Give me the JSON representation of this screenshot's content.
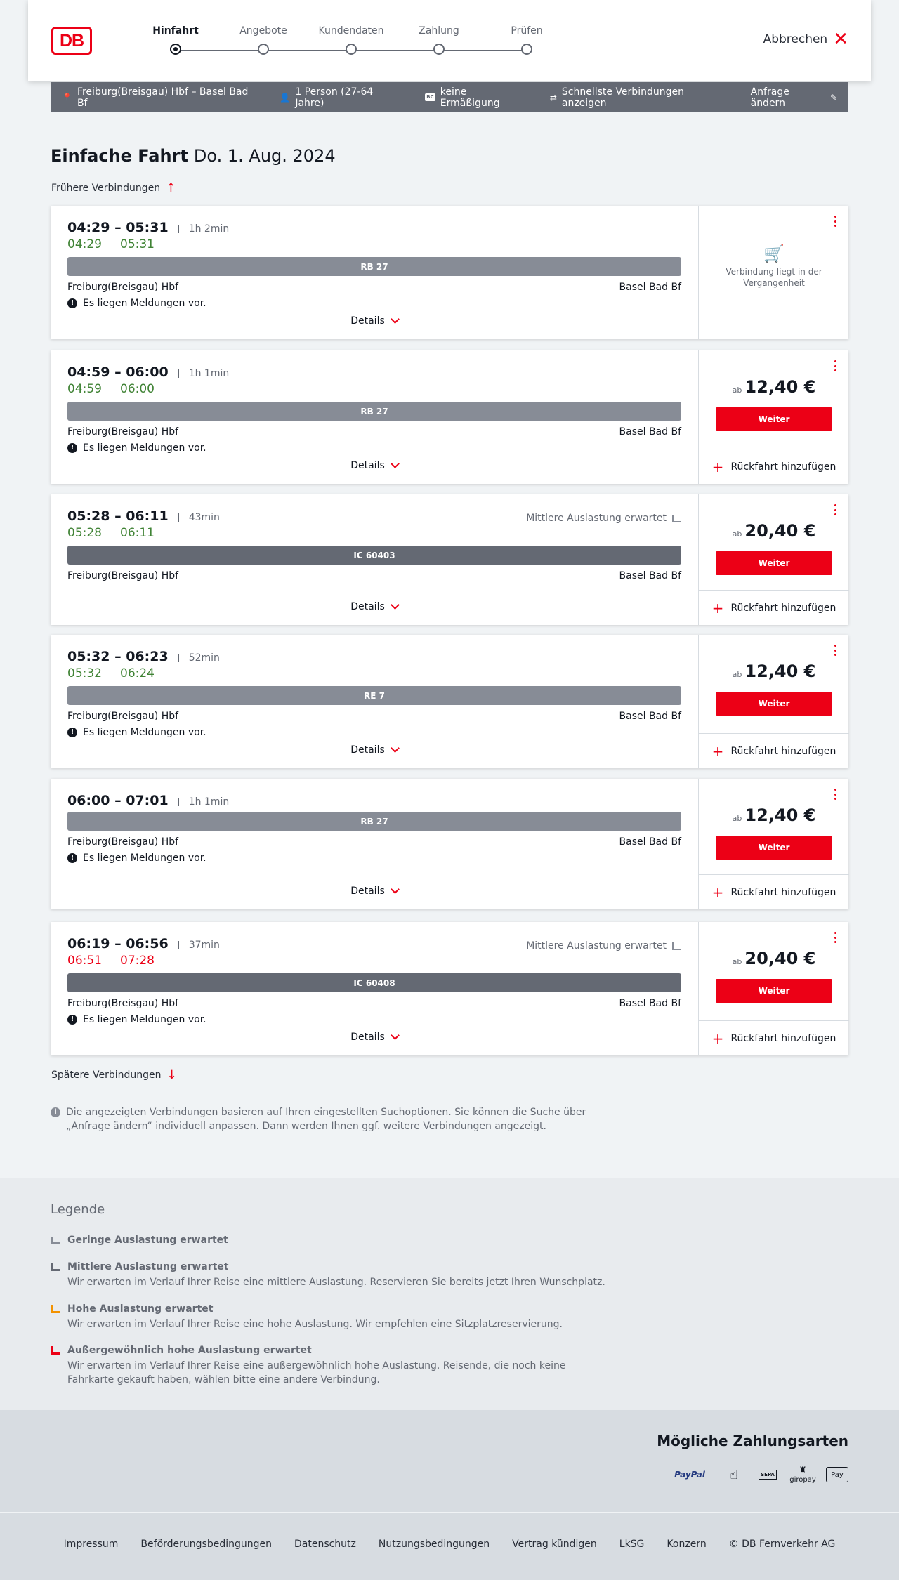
{
  "header": {
    "logo": "DB",
    "steps": [
      {
        "label": "Hinfahrt",
        "active": true
      },
      {
        "label": "Angebote"
      },
      {
        "label": "Kundendaten"
      },
      {
        "label": "Zahlung"
      },
      {
        "label": "Prüfen"
      }
    ],
    "cancel": "Abbrechen"
  },
  "bar": {
    "route": "Freiburg(Breisgau) Hbf – Basel Bad Bf",
    "persons": "1 Person (27-64 Jahre)",
    "discount": "keine Ermäßigung",
    "fastest": "Schnellste Verbindungen anzeigen",
    "edit": "Anfrage ändern"
  },
  "page": {
    "title": "Einfache Fahrt",
    "date": "Do. 1. Aug. 2024",
    "earlier": "Frühere Verbindungen",
    "later": "Spätere Verbindungen"
  },
  "labels": {
    "details": "Details",
    "from": "Freiburg(Breisgau) Hbf",
    "to": "Basel Bad Bf",
    "message": "Es liegen Meldungen vor.",
    "ab": "ab",
    "weiter": "Weiter",
    "return": "Rückfahrt hinzufügen",
    "past": "Verbindung liegt in der Vergangenheit"
  },
  "connections": [
    {
      "times": "04:29 – 05:31",
      "duration": "1h 2min",
      "rt_dep": "04:29",
      "rt_arr": "05:31",
      "late": false,
      "train": "RB 27",
      "train_color": "#878c96",
      "message": true,
      "past": true,
      "price": "",
      "occupancy": ""
    },
    {
      "times": "04:59 – 06:00",
      "duration": "1h 1min",
      "rt_dep": "04:59",
      "rt_arr": "06:00",
      "late": false,
      "train": "RB 27",
      "train_color": "#878c96",
      "message": true,
      "past": false,
      "price": "12,40 €",
      "occupancy": ""
    },
    {
      "times": "05:28 – 06:11",
      "duration": "43min",
      "rt_dep": "05:28",
      "rt_arr": "06:11",
      "late": false,
      "train": "IC 60403",
      "train_color": "#646973",
      "message": false,
      "past": false,
      "price": "20,40 €",
      "occupancy": "Mittlere Auslastung erwartet"
    },
    {
      "times": "05:32 – 06:23",
      "duration": "52min",
      "rt_dep": "05:32",
      "rt_arr": "06:24",
      "late": false,
      "train": "RE 7",
      "train_color": "#878c96",
      "message": true,
      "past": false,
      "price": "12,40 €",
      "occupancy": ""
    },
    {
      "times": "06:00 – 07:01",
      "duration": "1h 1min",
      "rt_dep": "",
      "rt_arr": "",
      "late": false,
      "train": "RB 27",
      "train_color": "#878c96",
      "message": true,
      "past": false,
      "price": "12,40 €",
      "occupancy": ""
    },
    {
      "times": "06:19 – 06:56",
      "duration": "37min",
      "rt_dep": "06:51",
      "rt_arr": "07:28",
      "late": true,
      "train": "IC 60408",
      "train_color": "#646973",
      "message": true,
      "past": false,
      "price": "20,40 €",
      "occupancy": "Mittlere Auslastung erwartet"
    }
  ],
  "info": "Die angezeigten Verbindungen basieren auf Ihren eingestellten Suchoptionen. Sie können die Suche über „Anfrage ändern“ individuell anpassen. Dann werden Ihnen ggf. weitere Verbindungen angezeigt.",
  "legend": {
    "title": "Legende",
    "items": [
      {
        "title": "Geringe Auslastung erwartet",
        "desc": "",
        "color": "#878c96"
      },
      {
        "title": "Mittlere Auslastung erwartet",
        "desc": "Wir erwarten im Verlauf Ihrer Reise eine mittlere Auslastung. Reservieren Sie bereits jetzt Ihren Wunschplatz.",
        "color": "#646973"
      },
      {
        "title": "Hohe Auslastung erwartet",
        "desc": "Wir erwarten im Verlauf Ihrer Reise eine hohe Auslastung. Wir empfehlen eine Sitzplatzreservierung.",
        "color": "#f39200"
      },
      {
        "title": "Außergewöhnlich hohe Auslastung erwartet",
        "desc": "Wir erwarten im Verlauf Ihrer Reise eine außergewöhnlich hohe Auslastung. Reisende, die noch keine Fahrkarte gekauft haben, wählen bitte eine andere Verbindung.",
        "color": "#ec0016"
      }
    ]
  },
  "payment": {
    "title": "Mögliche Zahlungsarten",
    "methods": [
      "PayPal",
      "",
      "SEPA",
      "giropay",
      "Pay"
    ]
  },
  "footer": {
    "links": [
      "Impressum",
      "Beförderungsbedingungen",
      "Datenschutz",
      "Nutzungsbedingungen",
      "Vertrag kündigen",
      "LkSG",
      "Konzern",
      "© DB Fernverkehr AG"
    ]
  }
}
